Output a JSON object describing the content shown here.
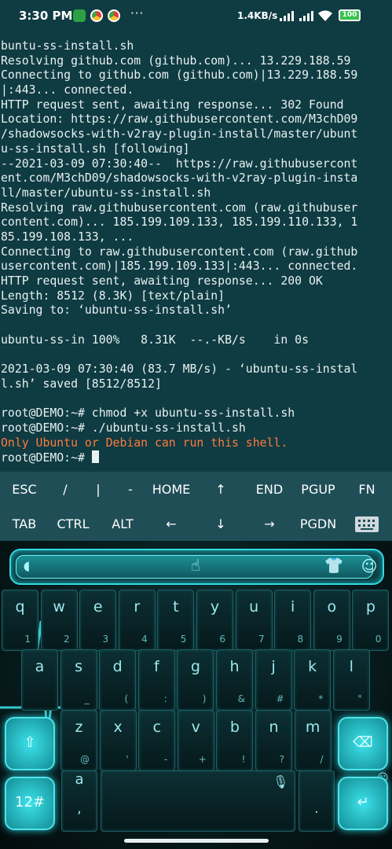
{
  "status_bar": {
    "time": "3:30 PM",
    "more": "···",
    "net_speed": "1.4KB/s",
    "battery": "100",
    "colors": {
      "bg": "#0f3b42",
      "battery": "#37c24b"
    }
  },
  "terminal": {
    "lines": [
      "buntu-ss-install.sh",
      "Resolving github.com (github.com)... 13.229.188.59",
      "Connecting to github.com (github.com)|13.229.188.59",
      "|:443... connected.",
      "HTTP request sent, awaiting response... 302 Found",
      "Location: https://raw.githubusercontent.com/M3chD09",
      "/shadowsocks-with-v2ray-plugin-install/master/ubunt",
      "u-ss-install.sh [following]",
      "--2021-03-09 07:30:40--  https://raw.githubusercont",
      "ent.com/M3chD09/shadowsocks-with-v2ray-plugin-insta",
      "ll/master/ubuntu-ss-install.sh",
      "Resolving raw.githubusercontent.com (raw.githubuser",
      "content.com)... 185.199.109.133, 185.199.110.133, 1",
      "85.199.108.133, ...",
      "Connecting to raw.githubusercontent.com (raw.github",
      "usercontent.com)|185.199.109.133|:443... connected.",
      "HTTP request sent, awaiting response... 200 OK",
      "Length: 8512 (8.3K) [text/plain]",
      "Saving to: ‘ubuntu-ss-install.sh’",
      "",
      "ubuntu-ss-in 100%   8.31K  --.-KB/s    in 0s",
      "",
      "2021-03-09 07:30:40 (83.7 MB/s) - ‘ubuntu-ss-instal",
      "l.sh’ saved [8512/8512]",
      "",
      "root@DEMO:~# chmod +x ubuntu-ss-install.sh",
      "root@DEMO:~# ./ubuntu-ss-install.sh",
      "Only Ubuntu or Debian can run this shell."
    ],
    "prompt": "root@DEMO:~# ",
    "colors": {
      "text": "#e8f1f2",
      "error": "#ff7a3d"
    }
  },
  "extra_keys": {
    "row1": [
      "ESC",
      "/",
      "|",
      "-",
      "HOME",
      "↑",
      "END",
      "PGUP",
      "FN"
    ],
    "row2": [
      "TAB",
      "CTRL",
      "ALT",
      "←",
      "↓",
      "→",
      "PGDN"
    ],
    "keyboard_icon": "keyboard-icon"
  },
  "keyboard": {
    "row1": [
      {
        "k": "q",
        "s": "1"
      },
      {
        "k": "w",
        "s": "2"
      },
      {
        "k": "e",
        "s": "3"
      },
      {
        "k": "r",
        "s": "4"
      },
      {
        "k": "t",
        "s": "5"
      },
      {
        "k": "y",
        "s": "6"
      },
      {
        "k": "u",
        "s": "7"
      },
      {
        "k": "i",
        "s": "8"
      },
      {
        "k": "o",
        "s": "9"
      },
      {
        "k": "p",
        "s": "0"
      }
    ],
    "row2": [
      {
        "k": "a",
        "s": ""
      },
      {
        "k": "s",
        "s": "_"
      },
      {
        "k": "d",
        "s": "("
      },
      {
        "k": "f",
        "s": ":"
      },
      {
        "k": "g",
        "s": ")"
      },
      {
        "k": "h",
        "s": "&"
      },
      {
        "k": "j",
        "s": "#"
      },
      {
        "k": "k",
        "s": "*"
      },
      {
        "k": "l",
        "s": "\""
      }
    ],
    "row3": [
      {
        "k": "z",
        "s": "@"
      },
      {
        "k": "x",
        "s": "'"
      },
      {
        "k": "c",
        "s": "-"
      },
      {
        "k": "v",
        "s": "+"
      },
      {
        "k": "b",
        "s": "!"
      },
      {
        "k": "n",
        "s": "?"
      },
      {
        "k": "m",
        "s": "/"
      }
    ],
    "shift_icon": "shift-icon",
    "backspace_icon": "backspace-icon",
    "symbols_label": "12#",
    "space_hint": "a",
    "comma": ",",
    "period": ".",
    "enter_icon": "enter-icon",
    "mic_icon": "mic-icon",
    "emoji_icon": "emoji-icon",
    "colors": {
      "accent": "#33d9e0",
      "key_text": "#9be9ee"
    }
  }
}
